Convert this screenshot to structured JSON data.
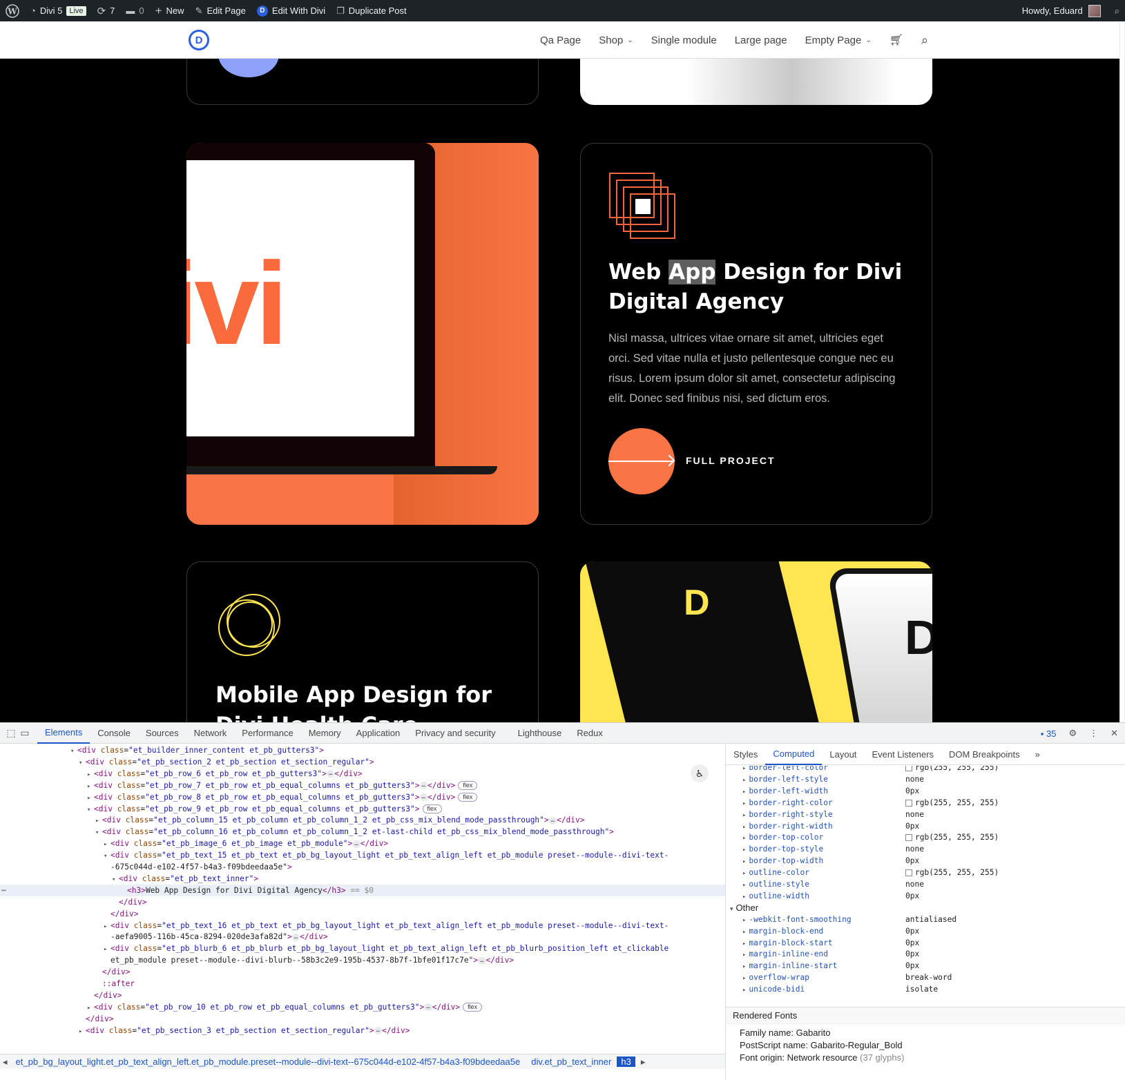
{
  "adminbar": {
    "site_name": "Divi 5",
    "live_badge": "Live",
    "updates_count": "7",
    "comments_count": "0",
    "new_label": "New",
    "edit_page_label": "Edit Page",
    "edit_with_divi_label": "Edit With Divi",
    "duplicate_post_label": "Duplicate Post",
    "howdy_label": "Howdy, Eduard"
  },
  "header": {
    "logo_letter": "D",
    "nav": [
      "Qa Page",
      "Shop",
      "Single module",
      "Large page",
      "Empty Page"
    ]
  },
  "cards": {
    "laptop_brand_text": "ivi",
    "web_app": {
      "title_pre": "Web ",
      "title_highlight": "App",
      "title_post": " Design for Divi Digital Agency",
      "body": "Nisl massa, ultrices vitae ornare sit amet, ultricies eget orci. Sed vitae nulla et justo pellentesque congue nec eu risus. Lorem ipsum dolor sit amet, consectetur adipiscing elit. Donec sed finibus nisi, sed dictum eros.",
      "cta_label": "FULL PROJECT"
    },
    "mobile_app": {
      "title": "Mobile App Design for Divi Health Care"
    },
    "yellow_letter_1": "D",
    "yellow_letter_2": "D"
  },
  "devtools": {
    "tabs": [
      "Elements",
      "Console",
      "Sources",
      "Network",
      "Performance",
      "Memory",
      "Application",
      "Privacy and security",
      "Lighthouse",
      "Redux"
    ],
    "issues_count": "35",
    "dom_lines": [
      {
        "indent": 0,
        "tri": "▾",
        "html": "<div class=\"et_builder_inner_content et_pb_gutters3\">"
      },
      {
        "indent": 1,
        "tri": "▾",
        "html": "<div class=\"et_pb_section_2 et_pb_section et_section_regular\">"
      },
      {
        "indent": 2,
        "tri": "▸",
        "html": "<div class=\"et_pb_row_6 et_pb_row et_pb_gutters3\">",
        "ell": true,
        "close": "</div>"
      },
      {
        "indent": 2,
        "tri": "▸",
        "html": "<div class=\"et_pb_row_7 et_pb_row et_pb_equal_columns et_pb_gutters3\">",
        "ell": true,
        "close": "</div>",
        "badge": "flex"
      },
      {
        "indent": 2,
        "tri": "▸",
        "html": "<div class=\"et_pb_row_8 et_pb_row et_pb_equal_columns et_pb_gutters3\">",
        "ell": true,
        "close": "</div>",
        "badge": "flex"
      },
      {
        "indent": 2,
        "tri": "▾",
        "html": "<div class=\"et_pb_row_9 et_pb_row et_pb_equal_columns et_pb_gutters3\">",
        "badge": "flex"
      },
      {
        "indent": 3,
        "tri": "▸",
        "html": "<div class=\"et_pb_column_15 et_pb_column et_pb_column_1_2 et_pb_css_mix_blend_mode_passthrough\">",
        "ell": true,
        "close": "</div>"
      },
      {
        "indent": 3,
        "tri": "▾",
        "html": "<div class=\"et_pb_column_16 et_pb_column et_pb_column_1_2 et-last-child et_pb_css_mix_blend_mode_passthrough\">"
      },
      {
        "indent": 4,
        "tri": "▸",
        "html": "<div class=\"et_pb_image_6 et_pb_image et_pb_module\">",
        "ell": true,
        "close": "</div>"
      },
      {
        "indent": 4,
        "tri": "▾",
        "html": "<div class=\"et_pb_text_15 et_pb_text et_pb_bg_layout_light et_pb_text_align_left et_pb_module preset--module--divi-text-"
      },
      {
        "indent": 4,
        "tri": "",
        "html": "-675c044d-e102-4f57-b4a3-f09bdeedaa5e\">"
      },
      {
        "indent": 5,
        "tri": "▾",
        "html": "<div class=\"et_pb_text_inner\">"
      },
      {
        "indent": 6,
        "tri": "",
        "html": "<h3>Web App Design for Divi Digital Agency</h3> == $0",
        "selected": true
      },
      {
        "indent": 5,
        "tri": "",
        "html": "</div>"
      },
      {
        "indent": 4,
        "tri": "",
        "html": "</div>"
      },
      {
        "indent": 4,
        "tri": "▸",
        "html": "<div class=\"et_pb_text_16 et_pb_text et_pb_bg_layout_light et_pb_text_align_left et_pb_module preset--module--divi-text-"
      },
      {
        "indent": 4,
        "tri": "",
        "html": "-aefa9005-116b-45ca-8294-020de3afa82d\">",
        "ell": true,
        "close": "</div>"
      },
      {
        "indent": 4,
        "tri": "▸",
        "html": "<div class=\"et_pb_blurb_6 et_pb_blurb et_pb_bg_layout_light et_pb_text_align_left et_pb_blurb_position_left et_clickable"
      },
      {
        "indent": 4,
        "tri": "",
        "html": "et_pb_module preset--module--divi-blurb--58b3c2e9-195b-4537-8b7f-1bfe01f17c7e\">",
        "ell": true,
        "close": "</div>"
      },
      {
        "indent": 3,
        "tri": "",
        "html": "</div>"
      },
      {
        "indent": 3,
        "tri": "",
        "html": "::after"
      },
      {
        "indent": 2,
        "tri": "",
        "html": "</div>"
      },
      {
        "indent": 2,
        "tri": "▸",
        "html": "<div class=\"et_pb_row_10 et_pb_row et_pb_equal_columns et_pb_gutters3\">",
        "ell": true,
        "close": "</div>",
        "badge": "flex"
      },
      {
        "indent": 1,
        "tri": "",
        "html": "</div>"
      },
      {
        "indent": 1,
        "tri": "▸",
        "html": "<div class=\"et_pb_section_3 et_pb_section et_section_regular\">",
        "ell": true,
        "close": "</div>"
      }
    ],
    "breadcrumb": [
      "et_pb_bg_layout_light.et_pb_text_align_left.et_pb_module.preset--module--divi-text--675c044d-e102-4f57-b4a3-f09bdeedaa5e",
      "div.et_pb_text_inner",
      "h3"
    ],
    "side_tabs": [
      "Styles",
      "Computed",
      "Layout",
      "Event Listeners",
      "DOM Breakpoints"
    ],
    "computed": [
      {
        "prop": "border-left-color",
        "val": "rgb(255, 255, 255)",
        "swatch": true
      },
      {
        "prop": "border-left-style",
        "val": "none"
      },
      {
        "prop": "border-left-width",
        "val": "0px"
      },
      {
        "prop": "border-right-color",
        "val": "rgb(255, 255, 255)",
        "swatch": true
      },
      {
        "prop": "border-right-style",
        "val": "none"
      },
      {
        "prop": "border-right-width",
        "val": "0px"
      },
      {
        "prop": "border-top-color",
        "val": "rgb(255, 255, 255)",
        "swatch": true
      },
      {
        "prop": "border-top-style",
        "val": "none"
      },
      {
        "prop": "border-top-width",
        "val": "0px"
      },
      {
        "prop": "outline-color",
        "val": "rgb(255, 255, 255)",
        "swatch": true
      },
      {
        "prop": "outline-style",
        "val": "none"
      },
      {
        "prop": "outline-width",
        "val": "0px"
      }
    ],
    "other_header": "Other",
    "other": [
      {
        "prop": "-webkit-font-smoothing",
        "val": "antialiased"
      },
      {
        "prop": "margin-block-end",
        "val": "0px"
      },
      {
        "prop": "margin-block-start",
        "val": "0px"
      },
      {
        "prop": "margin-inline-end",
        "val": "0px"
      },
      {
        "prop": "margin-inline-start",
        "val": "0px"
      },
      {
        "prop": "overflow-wrap",
        "val": "break-word"
      },
      {
        "prop": "unicode-bidi",
        "val": "isolate"
      }
    ],
    "rendered_fonts": {
      "header": "Rendered Fonts",
      "family": "Family name: Gabarito",
      "postscript": "PostScript name: Gabarito-Regular_Bold",
      "origin": "Font origin: Network resource",
      "glyphs": "(37 glyphs)"
    }
  }
}
